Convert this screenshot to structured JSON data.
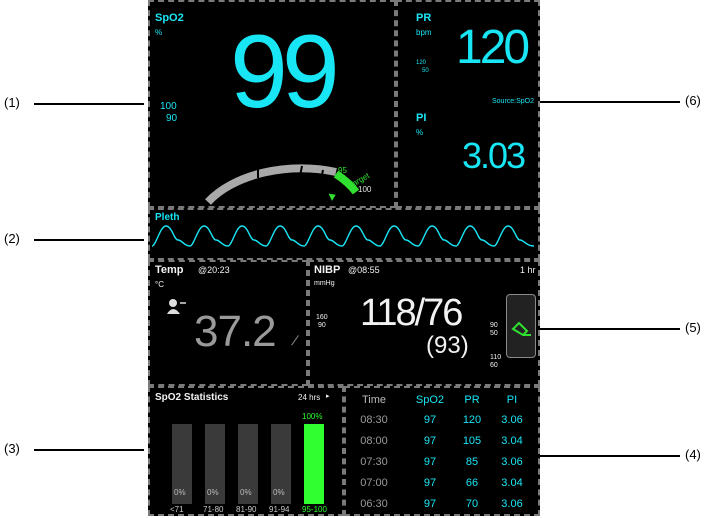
{
  "callouts": {
    "c1": "(1)",
    "c2": "(2)",
    "c3": "(3)",
    "c4": "(4)",
    "c5": "(5)",
    "c6": "(6)"
  },
  "spo2": {
    "label": "SpO2",
    "unit": "%",
    "value": "99",
    "limit_high": "100",
    "limit_low": "90",
    "gauge_95": "95",
    "gauge_target": "Target",
    "gauge_100": "100"
  },
  "pr": {
    "label": "PR",
    "unit": "bpm",
    "value": "120",
    "limit_high": "120",
    "limit_low": "50",
    "source": "Source:SpO2"
  },
  "pi": {
    "label": "PI",
    "unit": "%",
    "value": "3.03"
  },
  "pleth": {
    "label": "Pleth"
  },
  "temp": {
    "label": "Temp",
    "time": "@20:23",
    "unit": "°C",
    "value": "37.2"
  },
  "nibp": {
    "label": "NIBP",
    "time": "@08:55",
    "interval": "1 hr",
    "unit": "mmHg",
    "sys_high": "160",
    "sys_low": "90",
    "value": "118/76",
    "mean": "(93)",
    "dia_high": "90",
    "dia_low": "50",
    "map_high": "110",
    "map_low": "60"
  },
  "stats": {
    "title": "SpO2 Statistics",
    "range": "24 hrs",
    "bars": [
      {
        "pct_label": "0%",
        "range": "<71",
        "percent": 0
      },
      {
        "pct_label": "0%",
        "range": "71-80",
        "percent": 0
      },
      {
        "pct_label": "0%",
        "range": "81-90",
        "percent": 0
      },
      {
        "pct_label": "0%",
        "range": "91-94",
        "percent": 0
      },
      {
        "pct_label": "100%",
        "range": "95-100",
        "percent": 100
      }
    ]
  },
  "trend_table": {
    "headers": [
      "Time",
      "SpO2",
      "PR",
      "PI"
    ],
    "rows": [
      [
        "08:30",
        "97",
        "120",
        "3.06"
      ],
      [
        "08:00",
        "97",
        "105",
        "3.04"
      ],
      [
        "07:30",
        "97",
        "85",
        "3.06"
      ],
      [
        "07:00",
        "97",
        "66",
        "3.04"
      ],
      [
        "06:30",
        "97",
        "70",
        "3.06"
      ]
    ]
  },
  "colors": {
    "numeric": "#19e6f5",
    "stats_bar": "#30ff30",
    "background": "#000000"
  },
  "icons": {
    "patient": "patient-temp-icon",
    "cuff": "nibp-cuff-icon"
  }
}
